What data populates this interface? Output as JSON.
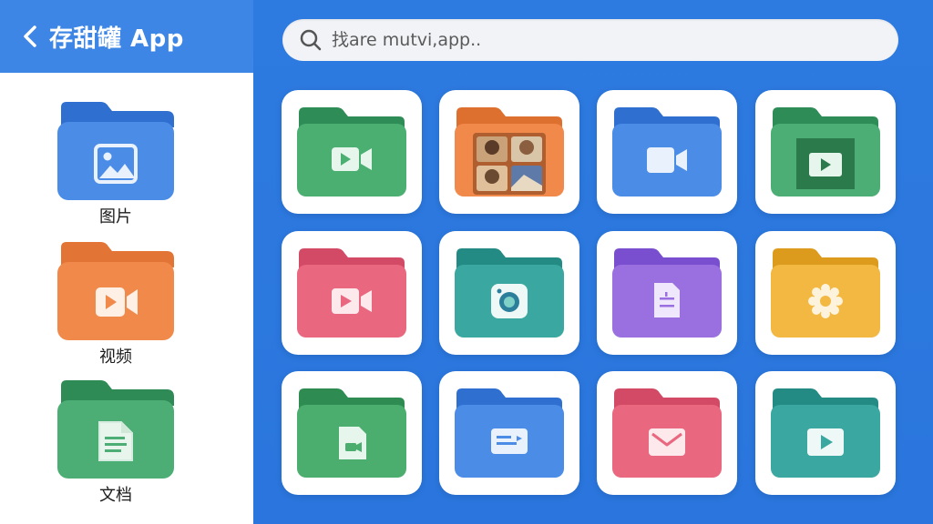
{
  "header": {
    "title": "存甜罐 App"
  },
  "search": {
    "placeholder": "找are mutvi,app.."
  },
  "sidebar": {
    "items": [
      {
        "label": "图片",
        "icon": "image-icon",
        "color": "#4a8ce6"
      },
      {
        "label": "视频",
        "icon": "video-camera-icon",
        "color": "#f0894a"
      },
      {
        "label": "文档",
        "icon": "document-icon",
        "color": "#4cae74"
      }
    ]
  },
  "grid": {
    "folders": [
      {
        "icon": "video-camera-icon",
        "color": "#4caf72"
      },
      {
        "icon": "photo-collage-icon",
        "color": "#f0894a"
      },
      {
        "icon": "video-camera-icon",
        "color": "#4a8ce6"
      },
      {
        "icon": "play-screen-icon",
        "color": "#4cae74"
      },
      {
        "icon": "video-camera-icon",
        "color": "#e9677f"
      },
      {
        "icon": "camera-app-icon",
        "color": "#3aa8a0"
      },
      {
        "icon": "document-icon",
        "color": "#9a6fe0"
      },
      {
        "icon": "gear-icon",
        "color": "#f2b842"
      },
      {
        "icon": "document-icon",
        "color": "#4cae6e"
      },
      {
        "icon": "screen-icon",
        "color": "#4a8ce6"
      },
      {
        "icon": "mail-icon",
        "color": "#e9677f"
      },
      {
        "icon": "play-screen-icon",
        "color": "#3aa8a0"
      }
    ]
  }
}
